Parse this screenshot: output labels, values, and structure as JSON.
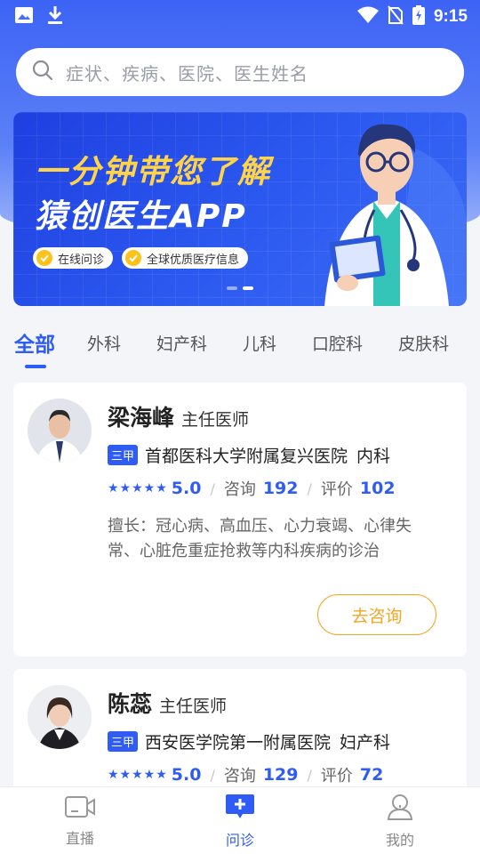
{
  "status_bar": {
    "time": "9:15"
  },
  "search": {
    "placeholder": "症状、疾病、医院、医生姓名"
  },
  "banner": {
    "title_line1": "一分钟带您了解",
    "title_line2": "猿创医生APP",
    "tags": [
      "在线问诊",
      "全球优质医疗信息"
    ]
  },
  "tabs": [
    "全部",
    "外科",
    "妇产科",
    "儿科",
    "口腔科",
    "皮肤科"
  ],
  "doctors": [
    {
      "name": "梁海峰",
      "title": "主任医师",
      "badge": "三甲",
      "hospital": "首都医科大学附属复兴医院",
      "department": "内科",
      "stars": "★★★★★",
      "score": "5.0",
      "consult_label": "咨询",
      "consult_count": "192",
      "review_label": "评价",
      "review_count": "102",
      "expertise": "擅长：冠心病、高血压、心力衰竭、心律失常、心脏危重症抢救等内科疾病的诊治",
      "button": "去咨询"
    },
    {
      "name": "陈蕊",
      "title": "主任医师",
      "badge": "三甲",
      "hospital": "西安医学院第一附属医院",
      "department": "妇产科",
      "stars": "★★★★★",
      "score": "5.0",
      "consult_label": "咨询",
      "consult_count": "129",
      "review_label": "评价",
      "review_count": "72"
    }
  ],
  "bottom_nav": [
    {
      "label": "直播",
      "icon": "video-icon"
    },
    {
      "label": "问诊",
      "icon": "consult-icon"
    },
    {
      "label": "我的",
      "icon": "user-icon"
    }
  ],
  "colors": {
    "primary": "#2f5cf5",
    "accent": "#f5a623",
    "banner_yellow": "#ffd44a"
  }
}
